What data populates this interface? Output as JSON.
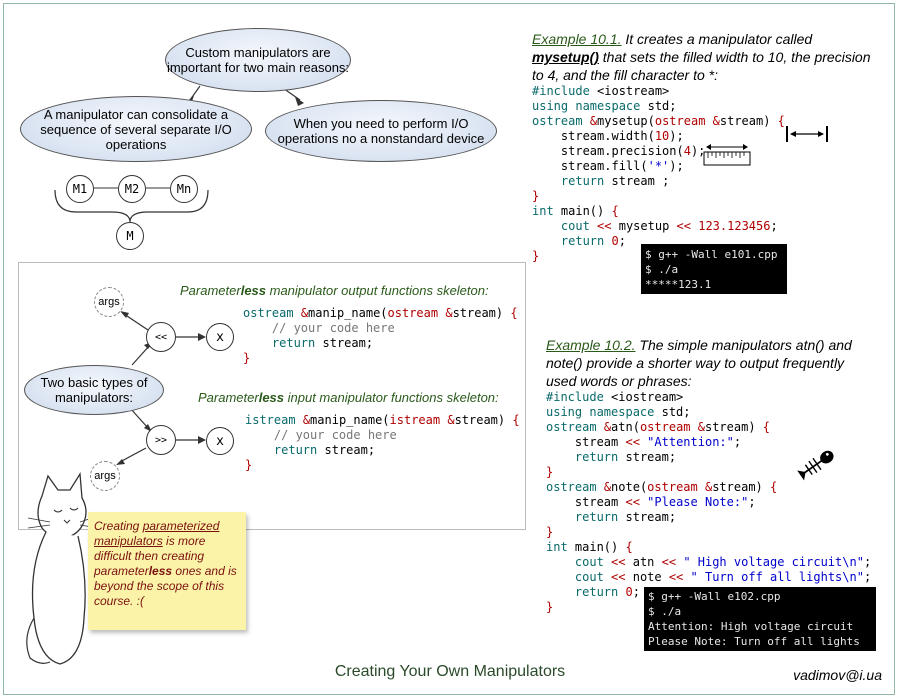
{
  "footer": {
    "title": "Creating Your Own Manipulators",
    "email": "vadimov@i.ua"
  },
  "mindmap": {
    "top": "Custom manipulators are important for two main reasons:",
    "left": "A manipulator can consolidate a sequence of several separate I/O operations",
    "right": "When you need to perform I/O operations no a nonstandard device",
    "m1": "M1",
    "m2": "M2",
    "mn": "Mn",
    "m": "M"
  },
  "types": {
    "center": "Two basic types of manipulators:",
    "args": "args",
    "out_op": "<<",
    "in_op": ">>",
    "x": "x",
    "out_title_a": "Parameter",
    "out_title_b": "less",
    "out_title_c": " manipulator output functions skeleton:",
    "in_title_a": "Parameter",
    "in_title_b": "less",
    "in_title_c": " input manipulator functions skeleton:"
  },
  "note": {
    "a": "Creating ",
    "b": "parameterized manipulators",
    "c": " is more difficult then creating parameter",
    "d": "less",
    "e": " ones and is beyond the scope of this course.  :("
  },
  "ex1": {
    "label": "Example 10.1.",
    "desc_a": " It creates a manipulator called ",
    "desc_b": "mysetup()",
    "desc_c": " that sets the filled width to 10, the precision to 4, and the fill character to *:",
    "terminal": [
      "$ g++ -Wall e101.cpp",
      "$ ./a",
      "*****123.1"
    ]
  },
  "ex2": {
    "label": "Example 10.2.",
    "desc": " The simple manipulators atn() and note() provide a shorter way to output frequently used words or phrases:",
    "terminal": [
      "$ g++ -Wall e102.cpp",
      "$ ./a",
      "Attention: High voltage circuit",
      "Please Note: Turn off all lights"
    ]
  },
  "icons": [
    "width-arrow-icon",
    "ruler-icon",
    "fish-bone-icon",
    "cat-icon"
  ]
}
